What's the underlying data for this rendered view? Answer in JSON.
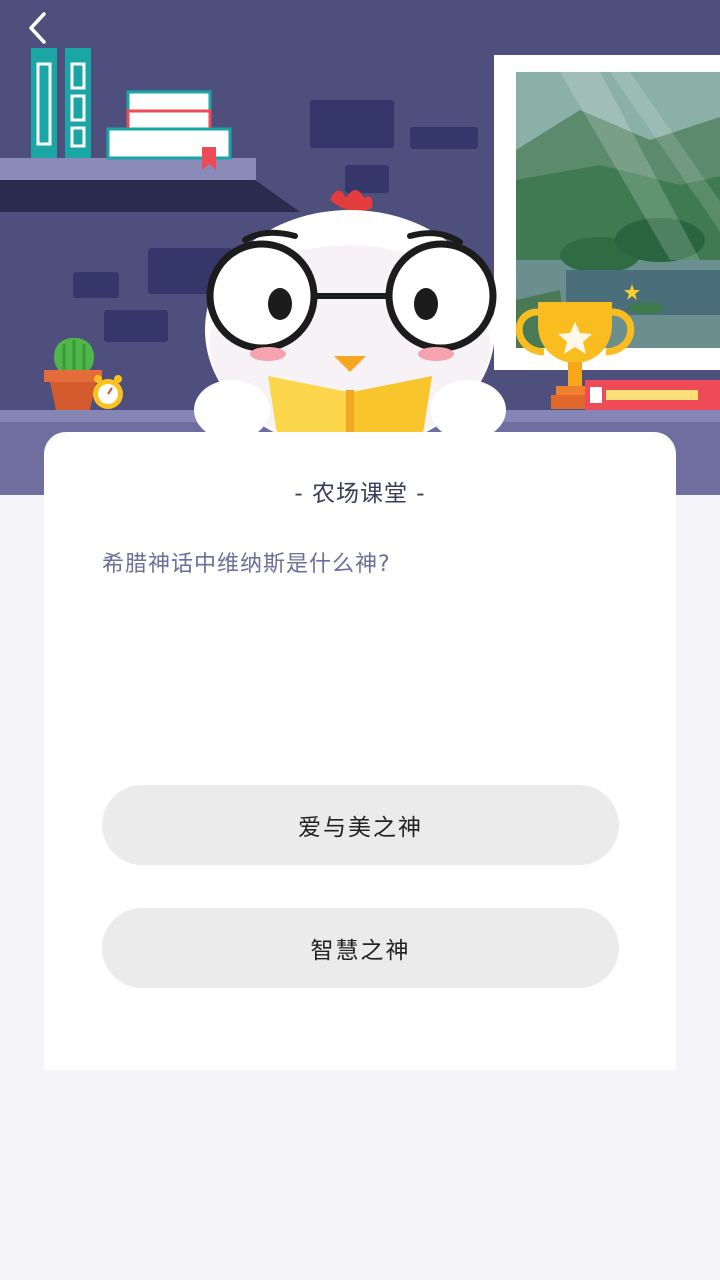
{
  "header": {
    "back_icon": "chevron-left-icon",
    "illustration": "chicken-reading-book-in-study-room"
  },
  "card": {
    "title": "- 农场课堂 -",
    "question": "希腊神话中维纳斯是什么神?",
    "options": [
      {
        "label": "爱与美之神"
      },
      {
        "label": "智慧之神"
      }
    ]
  },
  "colors": {
    "wall": "#4f4f7e",
    "wall_brick": "#35376a",
    "shelf": "#8586b5",
    "card_bg": "#ffffff",
    "page_bg": "#f4f4f9",
    "option_bg": "#ebebeb",
    "question_text": "#6c6e9c",
    "title_text": "#3a3d5c"
  }
}
